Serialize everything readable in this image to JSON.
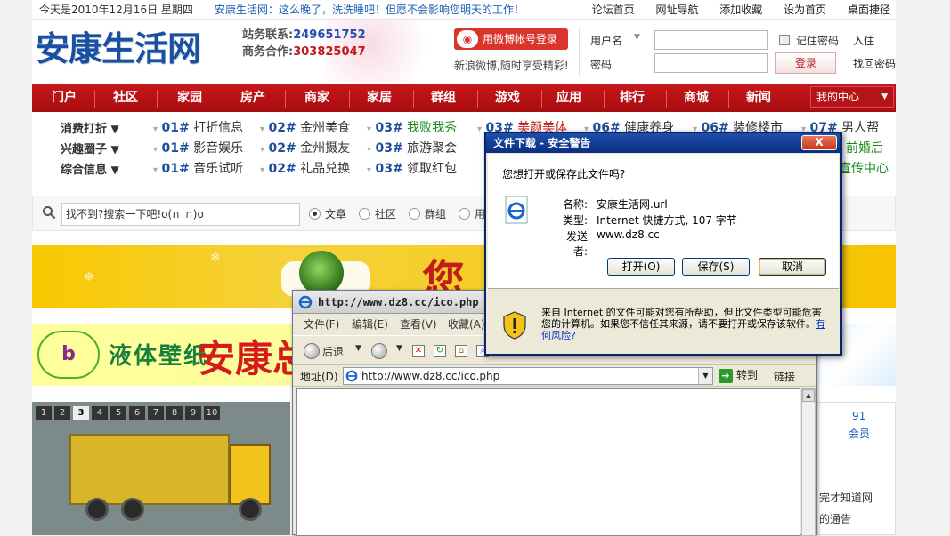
{
  "topbar": {
    "date": "今天是2010年12月16日 星期四",
    "slogan": "安康生活网：这么晚了，洗洗睡吧！但愿不会影响您明天的工作！",
    "links": [
      "论坛首页",
      "网址导航",
      "添加收藏",
      "设为首页",
      "桌面捷径"
    ]
  },
  "header": {
    "logo": "安康生活网",
    "contact_label1": "站务联系:",
    "contact_num1": "249651752",
    "contact_label2": "商务合作:",
    "contact_num2": "303825047",
    "weibo_btn": "用微博帐号登录",
    "weibo_tip": "新浪微博,随时享受精彩!",
    "username_label": "用户名",
    "password_label": "密码",
    "username_value": "",
    "password_value": "",
    "remember": "记住密码",
    "login_btn": "登录",
    "join": "入住",
    "forgot": "找回密码"
  },
  "nav": {
    "items": [
      "门户",
      "社区",
      "家园",
      "房产",
      "商家",
      "家居",
      "群组",
      "游戏",
      "应用",
      "排行",
      "商城",
      "新闻"
    ],
    "my_center": "我的中心"
  },
  "subnav": {
    "rows": [
      {
        "cat": "消费打折",
        "links": [
          {
            "no": "01#",
            "text": "打折信息"
          },
          {
            "no": "02#",
            "text": "金州美食"
          },
          {
            "no": "03#",
            "text": "我败我秀",
            "green": true
          },
          {
            "no": "03#",
            "text": "美颜美体"
          },
          {
            "no": "06#",
            "text": "健康养身"
          },
          {
            "no": "06#",
            "text": "装修楼市"
          },
          {
            "no": "07#",
            "text": "男人帮"
          }
        ]
      },
      {
        "cat": "兴趣圈子",
        "links": [
          {
            "no": "01#",
            "text": "影音娱乐"
          },
          {
            "no": "02#",
            "text": "金州摄友"
          },
          {
            "no": "03#",
            "text": "旅游聚会"
          }
        ],
        "tail": "前婚后"
      },
      {
        "cat": "综合信息",
        "links": [
          {
            "no": "01#",
            "text": "音乐试听"
          },
          {
            "no": "02#",
            "text": "礼品兑换"
          },
          {
            "no": "03#",
            "text": "领取红包"
          }
        ],
        "tail": "宣传中心"
      }
    ]
  },
  "search": {
    "value": "找不到?搜索一下吧!o(∩_∩)o",
    "options": [
      "文章",
      "社区",
      "群组",
      "用"
    ]
  },
  "banner1": {
    "text": "您"
  },
  "banner2": {
    "logo": "b",
    "text1": "液体壁纸",
    "text2": "安康总"
  },
  "slider": {
    "pages": [
      "1",
      "2",
      "3",
      "4",
      "5",
      "6",
      "7",
      "8",
      "9",
      "10"
    ],
    "active": "3"
  },
  "right_panel": {
    "count": "91",
    "label": "会员"
  },
  "right_texts": [
    "完才知道网",
    "的通告"
  ],
  "ie_window": {
    "title": "http://www.dz8.cc/ico.php - M",
    "menu": [
      "文件(F)",
      "编辑(E)",
      "查看(V)",
      "收藏(A)"
    ],
    "back": "后退",
    "address_label": "地址(D)",
    "address": "http://www.dz8.cc/ico.php",
    "go": "转到",
    "links": "链接"
  },
  "dialog": {
    "title": "文件下载 - 安全警告",
    "close": "X",
    "question": "您想打开或保存此文件吗?",
    "name_label": "名称:",
    "name_value": "安康生活网.url",
    "type_label": "类型:",
    "type_value": "Internet 快捷方式, 107 字节",
    "from_label": "发送者:",
    "from_value": "www.dz8.cc",
    "open_btn": "打开(O)",
    "save_btn": "保存(S)",
    "cancel_btn": "取消",
    "warning": "来自 Internet 的文件可能对您有所帮助，但此文件类型可能危害您的计算机。如果您不信任其来源，请不要打开或保存该软件。",
    "risk_link": "有何风险?"
  }
}
